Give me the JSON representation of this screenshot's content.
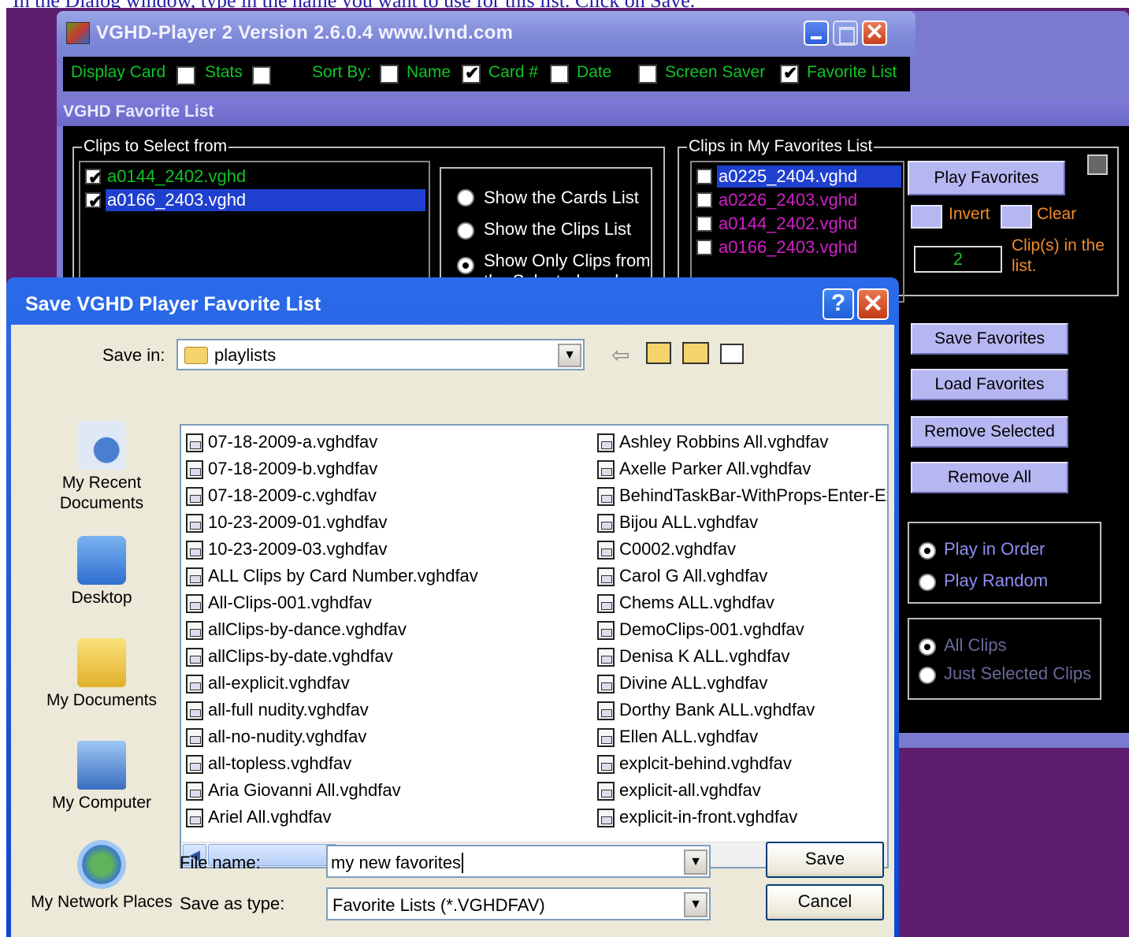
{
  "instruction": "In the Dialog window, type in the name you want to use for this list. Click on Save.",
  "main_window": {
    "title": "VGHD-Player 2  Version 2.6.0.4  www.lvnd.com",
    "close_glyph": "✕"
  },
  "options_bar": {
    "display_card": "Display Card",
    "stats": "Stats",
    "sort_by": "Sort By:",
    "name": "Name",
    "card_num": "Card #",
    "date": "Date",
    "screen_saver": "Screen Saver",
    "favorite_list": "Favorite List"
  },
  "favorites": {
    "panel_title": "VGHD Favorite List",
    "clips_to_select_label": "Clips to Select from",
    "clips_to_select": [
      "a0144_2402.vghd",
      "a0166_2403.vghd"
    ],
    "show_cards": "Show the Cards List",
    "show_clips": "Show the Clips List",
    "show_only_1": "Show Only Clips from",
    "show_only_2": "the Selected cards",
    "my_favorites_label": "Clips in My Favorites List",
    "my_favorites": [
      "a0225_2404.vghd",
      "a0226_2403.vghd",
      "a0144_2402.vghd",
      "a0166_2403.vghd"
    ],
    "play_favorites": "Play Favorites",
    "invert": "Invert",
    "clear": "Clear",
    "count": "2",
    "count_label_1": "Clip(s) in the",
    "count_label_2": "list.",
    "save_favorites": "Save Favorites",
    "load_favorites": "Load Favorites",
    "remove_selected": "Remove Selected",
    "remove_all": "Remove All",
    "play_in_order": "Play in Order",
    "play_random": "Play Random",
    "all_clips": "All Clips",
    "just_selected": "Just Selected Clips"
  },
  "dialog": {
    "title": "Save VGHD Player Favorite List",
    "help_glyph": "?",
    "close_glyph": "✕",
    "save_in_label": "Save in:",
    "save_in_value": "playlists",
    "places": [
      "My Recent Documents",
      "Desktop",
      "My Documents",
      "My Computer",
      "My Network Places"
    ],
    "files_col1": [
      "07-18-2009-a.vghdfav",
      "07-18-2009-b.vghdfav",
      "07-18-2009-c.vghdfav",
      "10-23-2009-01.vghdfav",
      "10-23-2009-03.vghdfav",
      "ALL Clips by Card Number.vghdfav",
      "All-Clips-001.vghdfav",
      "allClips-by-dance.vghdfav",
      "allClips-by-date.vghdfav",
      "all-explicit.vghdfav",
      "all-full nudity.vghdfav",
      "all-no-nudity.vghdfav",
      "all-topless.vghdfav",
      "Aria Giovanni All.vghdfav",
      "Ariel All.vghdfav"
    ],
    "files_col2": [
      "Ashley Robbins All.vghdfav",
      "Axelle Parker All.vghdfav",
      "BehindTaskBar-WithProps-Enter-Ex",
      "Bijou ALL.vghdfav",
      "C0002.vghdfav",
      "Carol G All.vghdfav",
      "Chems ALL.vghdfav",
      "DemoClips-001.vghdfav",
      "Denisa K ALL.vghdfav",
      "Divine ALL.vghdfav",
      "Dorthy Bank ALL.vghdfav",
      "Ellen ALL.vghdfav",
      "explcit-behind.vghdfav",
      "explicit-all.vghdfav",
      "explicit-in-front.vghdfav"
    ],
    "file_name_label": "File name:",
    "file_name_value": "my new favorites",
    "save_as_type_label": "Save as type:",
    "save_as_type_value": "Favorite Lists (*.VGHDFAV)",
    "save_button": "Save",
    "cancel_button": "Cancel"
  }
}
